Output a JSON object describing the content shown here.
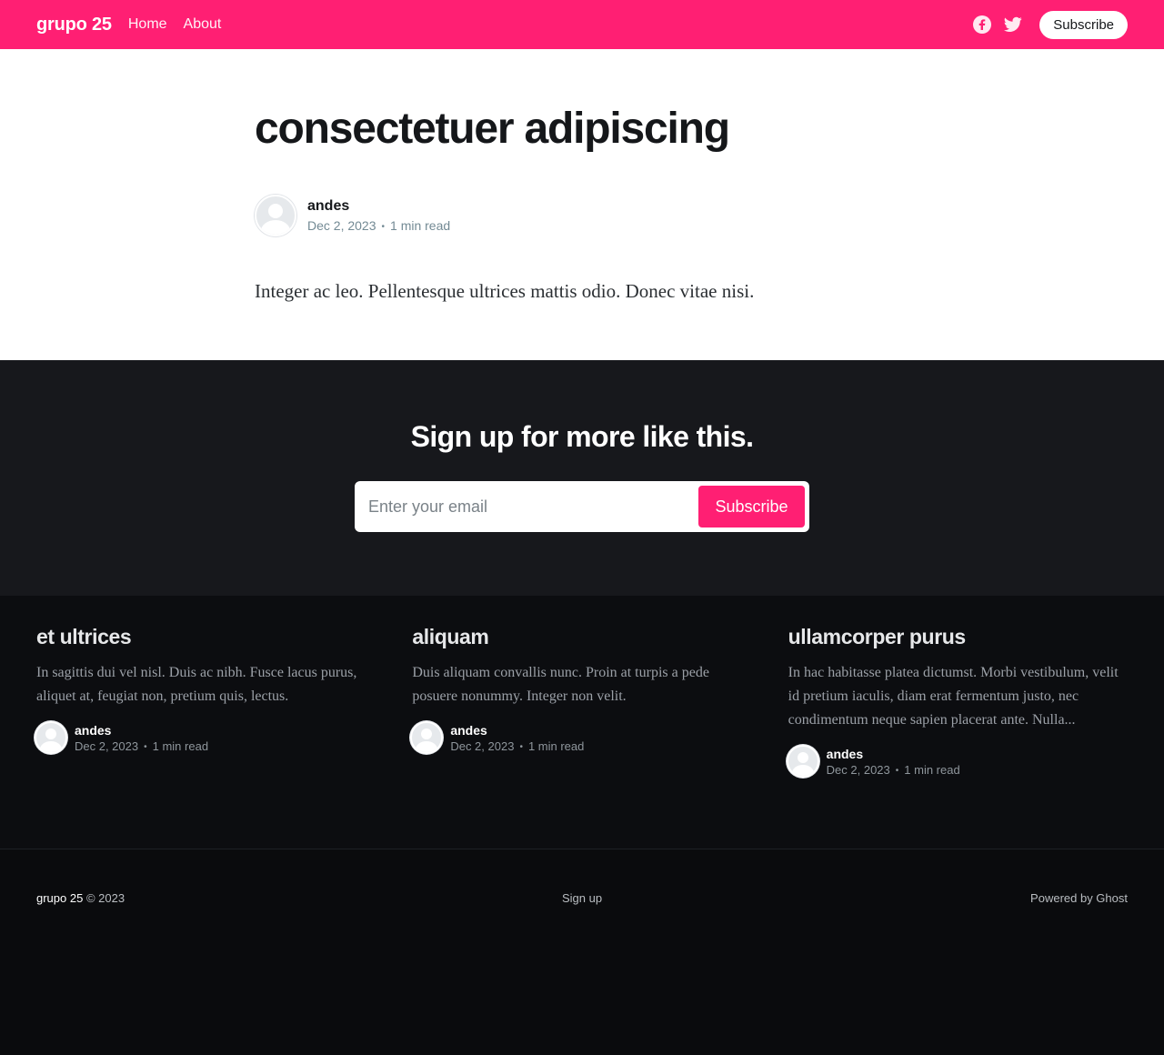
{
  "header": {
    "brand": "grupo 25",
    "nav": [
      "Home",
      "About"
    ],
    "icons": [
      "facebook-icon",
      "twitter-icon"
    ],
    "subscribe_label": "Subscribe",
    "background": "#ff1f73"
  },
  "article": {
    "title": "consectetuer adipiscing",
    "author": "andes",
    "date": "Dec 2, 2023",
    "read_time": "1 min read",
    "excerpt": "Integer ac leo. Pellentesque ultrices mattis odio. Donec vitae nisi."
  },
  "signup": {
    "heading": "Sign up for more like this.",
    "placeholder": "Enter your email",
    "button_label": "Subscribe",
    "accent": "#ff1f73"
  },
  "related": [
    {
      "title": "et ultrices",
      "excerpt": "In sagittis dui vel nisl. Duis ac nibh. Fusce lacus purus, aliquet at, feugiat non, pretium quis, lectus.",
      "author": "andes",
      "date": "Dec 2, 2023",
      "read_time": "1 min read"
    },
    {
      "title": "aliquam",
      "excerpt": "Duis aliquam convallis nunc. Proin at turpis a pede posuere nonummy. Integer non velit.",
      "author": "andes",
      "date": "Dec 2, 2023",
      "read_time": "1 min read"
    },
    {
      "title": "ullamcorper purus",
      "excerpt": "In hac habitasse platea dictumst. Morbi vestibulum, velit id pretium iaculis, diam erat fermentum justo, nec condimentum neque sapien placerat ante. Nulla...",
      "author": "andes",
      "date": "Dec 2, 2023",
      "read_time": "1 min read"
    }
  ],
  "footer": {
    "brand": "grupo 25",
    "copyright": "© 2023",
    "center_link": "Sign up",
    "powered": "Powered by Ghost"
  }
}
